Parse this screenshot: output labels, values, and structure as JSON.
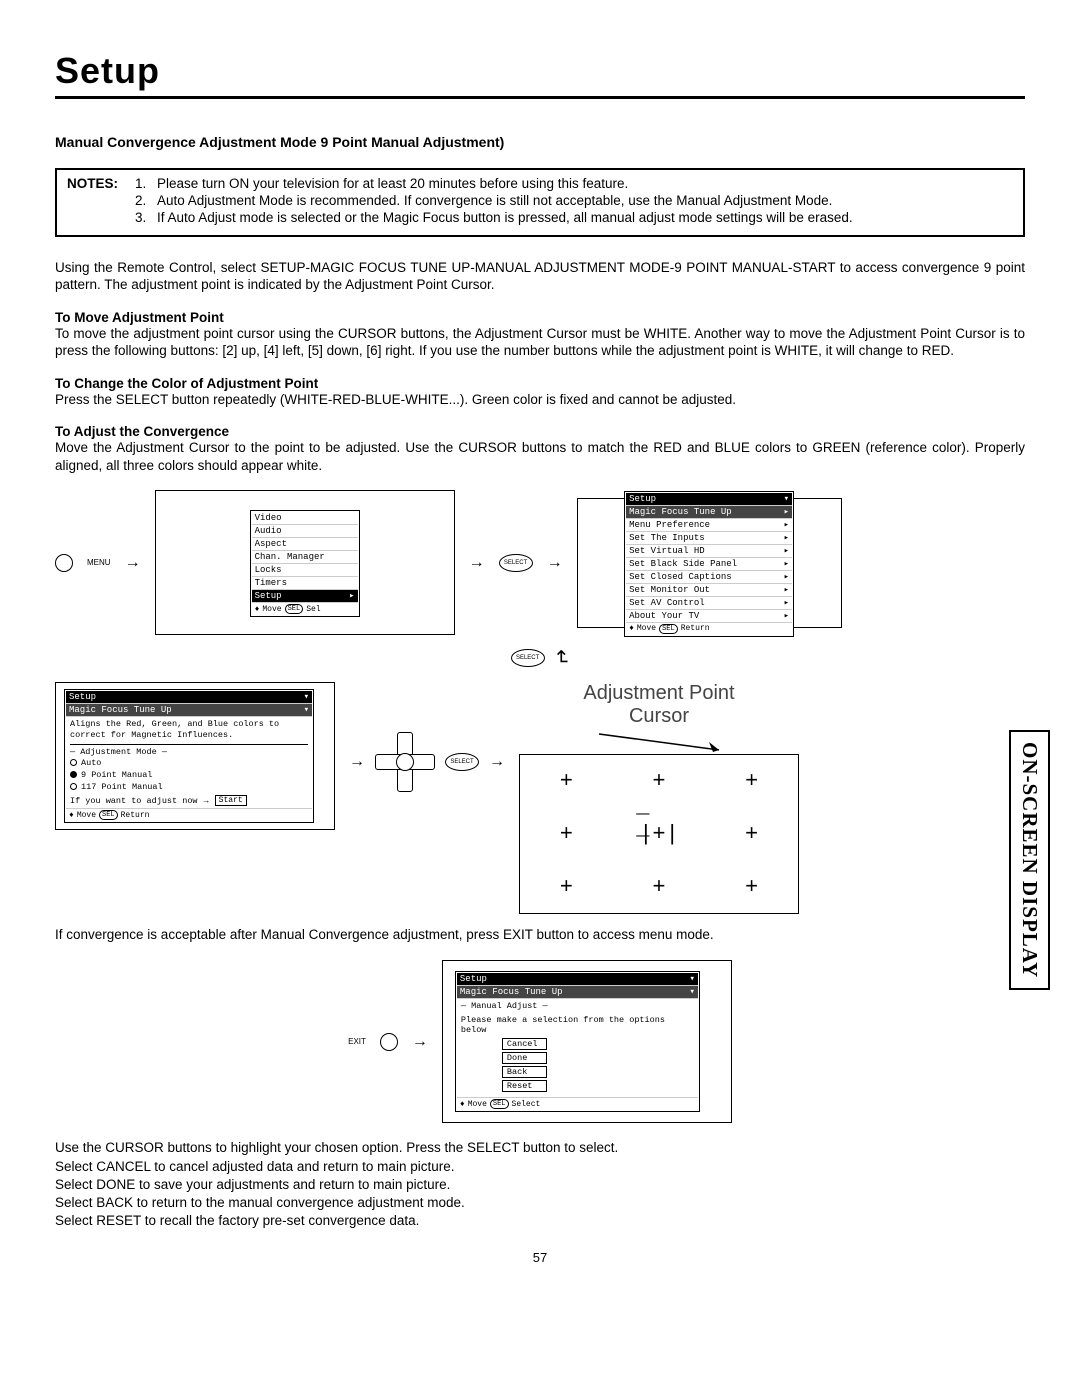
{
  "page_title": "Setup",
  "section_heading": "Manual Convergence Adjustment Mode 9 Point Manual Adjustment)",
  "notes_label": "NOTES:",
  "notes": [
    "Please turn ON your television for at least 20 minutes before using this feature.",
    "Auto Adjustment Mode is recommended. If convergence is still not acceptable, use the Manual Adjustment Mode.",
    "If Auto Adjust mode is selected or the Magic Focus button is pressed, all manual adjust mode settings will be erased."
  ],
  "intro_text": "Using the Remote Control, select SETUP-MAGIC FOCUS TUNE UP-MANUAL ADJUSTMENT MODE-9 POINT MANUAL-START to access convergence 9 point pattern. The adjustment point is indicated by the Adjustment Point Cursor.",
  "sub1_heading": "To Move Adjustment Point",
  "sub1_text": "To move the adjustment point cursor using the CURSOR buttons, the Adjustment Cursor must be WHITE. Another way to move the Adjustment Point Cursor is to press the following buttons: [2] up, [4] left, [5] down, [6] right. If you use the number buttons while the adjustment point is WHITE, it will change to RED.",
  "sub2_heading": "To Change the Color of Adjustment Point",
  "sub2_text": "Press the SELECT button repeatedly (WHITE-RED-BLUE-WHITE...). Green color is fixed and cannot be adjusted.",
  "sub3_heading": "To Adjust the Convergence",
  "sub3_text": "Move the Adjustment Cursor to the point to be adjusted. Use the CURSOR buttons to match the RED and BLUE colors to GREEN (reference color). Properly aligned, all three colors should appear white.",
  "menu_btn_label": "MENU",
  "select_btn_label": "SELECT",
  "exit_btn_label": "EXIT",
  "osd_menu1": [
    "Video",
    "Audio",
    "Aspect",
    "Chan. Manager",
    "Locks",
    "Timers",
    "Setup"
  ],
  "osd_menu1_footer": "Move",
  "osd_menu1_sel": "Sel",
  "osd_sel_badge": "SEL",
  "osd_menu2_title": "Setup",
  "osd_menu2": [
    "Magic Focus Tune Up",
    "Menu Preference",
    "Set The Inputs",
    "Set Virtual HD",
    "Set Black Side Panel",
    "Set Closed Captions",
    "Set Monitor Out",
    "Set AV Control",
    "About Your TV"
  ],
  "osd_menu2_footer_move": "Move",
  "osd_menu2_footer_return": "Return",
  "adj_cursor_label_1": "Adjustment Point",
  "adj_cursor_label_2": "Cursor",
  "osd3_title": "Setup",
  "osd3_sub": "Magic Focus Tune Up",
  "osd3_desc": "Aligns the Red, Green, and Blue colors to correct for Magnetic Influences.",
  "osd3_mode_label": "Adjustment Mode",
  "osd3_opts": [
    "Auto",
    "9 Point Manual",
    "117 Point Manual"
  ],
  "osd3_hint": "If you want to adjust now",
  "osd3_start": "Start",
  "osd3_footer_move": "Move",
  "osd3_footer_return": "Return",
  "after_text": "If convergence is acceptable after Manual Convergence adjustment, press EXIT button to access menu mode.",
  "osd4_title": "Setup",
  "osd4_sub": "Magic Focus Tune Up",
  "osd4_group": "Manual Adjust",
  "osd4_desc": "Please make a selection from the options below",
  "osd4_opts": [
    "Cancel",
    "Done",
    "Back",
    "Reset"
  ],
  "osd4_footer_move": "Move",
  "osd4_footer_select": "Select",
  "final_lines": [
    "Use the CURSOR buttons to highlight your chosen option. Press the SELECT button to select.",
    "Select CANCEL to cancel adjusted data and return to main picture.",
    "Select DONE to save your adjustments and return to main picture.",
    "Select BACK to return to the manual convergence adjustment mode.",
    "Select RESET to recall the factory pre-set convergence data."
  ],
  "page_number": "57",
  "side_tab": "ON-SCREEN DISPLAY"
}
